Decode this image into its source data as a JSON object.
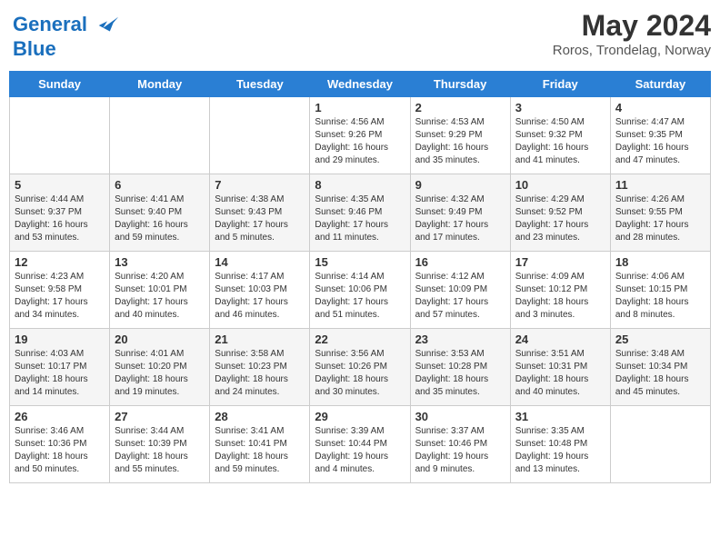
{
  "header": {
    "logo_line1": "General",
    "logo_line2": "Blue",
    "month_year": "May 2024",
    "location": "Roros, Trondelag, Norway"
  },
  "days_of_week": [
    "Sunday",
    "Monday",
    "Tuesday",
    "Wednesday",
    "Thursday",
    "Friday",
    "Saturday"
  ],
  "weeks": [
    [
      {
        "day": "",
        "info": ""
      },
      {
        "day": "",
        "info": ""
      },
      {
        "day": "",
        "info": ""
      },
      {
        "day": "1",
        "info": "Sunrise: 4:56 AM\nSunset: 9:26 PM\nDaylight: 16 hours\nand 29 minutes."
      },
      {
        "day": "2",
        "info": "Sunrise: 4:53 AM\nSunset: 9:29 PM\nDaylight: 16 hours\nand 35 minutes."
      },
      {
        "day": "3",
        "info": "Sunrise: 4:50 AM\nSunset: 9:32 PM\nDaylight: 16 hours\nand 41 minutes."
      },
      {
        "day": "4",
        "info": "Sunrise: 4:47 AM\nSunset: 9:35 PM\nDaylight: 16 hours\nand 47 minutes."
      }
    ],
    [
      {
        "day": "5",
        "info": "Sunrise: 4:44 AM\nSunset: 9:37 PM\nDaylight: 16 hours\nand 53 minutes."
      },
      {
        "day": "6",
        "info": "Sunrise: 4:41 AM\nSunset: 9:40 PM\nDaylight: 16 hours\nand 59 minutes."
      },
      {
        "day": "7",
        "info": "Sunrise: 4:38 AM\nSunset: 9:43 PM\nDaylight: 17 hours\nand 5 minutes."
      },
      {
        "day": "8",
        "info": "Sunrise: 4:35 AM\nSunset: 9:46 PM\nDaylight: 17 hours\nand 11 minutes."
      },
      {
        "day": "9",
        "info": "Sunrise: 4:32 AM\nSunset: 9:49 PM\nDaylight: 17 hours\nand 17 minutes."
      },
      {
        "day": "10",
        "info": "Sunrise: 4:29 AM\nSunset: 9:52 PM\nDaylight: 17 hours\nand 23 minutes."
      },
      {
        "day": "11",
        "info": "Sunrise: 4:26 AM\nSunset: 9:55 PM\nDaylight: 17 hours\nand 28 minutes."
      }
    ],
    [
      {
        "day": "12",
        "info": "Sunrise: 4:23 AM\nSunset: 9:58 PM\nDaylight: 17 hours\nand 34 minutes."
      },
      {
        "day": "13",
        "info": "Sunrise: 4:20 AM\nSunset: 10:01 PM\nDaylight: 17 hours\nand 40 minutes."
      },
      {
        "day": "14",
        "info": "Sunrise: 4:17 AM\nSunset: 10:03 PM\nDaylight: 17 hours\nand 46 minutes."
      },
      {
        "day": "15",
        "info": "Sunrise: 4:14 AM\nSunset: 10:06 PM\nDaylight: 17 hours\nand 51 minutes."
      },
      {
        "day": "16",
        "info": "Sunrise: 4:12 AM\nSunset: 10:09 PM\nDaylight: 17 hours\nand 57 minutes."
      },
      {
        "day": "17",
        "info": "Sunrise: 4:09 AM\nSunset: 10:12 PM\nDaylight: 18 hours\nand 3 minutes."
      },
      {
        "day": "18",
        "info": "Sunrise: 4:06 AM\nSunset: 10:15 PM\nDaylight: 18 hours\nand 8 minutes."
      }
    ],
    [
      {
        "day": "19",
        "info": "Sunrise: 4:03 AM\nSunset: 10:17 PM\nDaylight: 18 hours\nand 14 minutes."
      },
      {
        "day": "20",
        "info": "Sunrise: 4:01 AM\nSunset: 10:20 PM\nDaylight: 18 hours\nand 19 minutes."
      },
      {
        "day": "21",
        "info": "Sunrise: 3:58 AM\nSunset: 10:23 PM\nDaylight: 18 hours\nand 24 minutes."
      },
      {
        "day": "22",
        "info": "Sunrise: 3:56 AM\nSunset: 10:26 PM\nDaylight: 18 hours\nand 30 minutes."
      },
      {
        "day": "23",
        "info": "Sunrise: 3:53 AM\nSunset: 10:28 PM\nDaylight: 18 hours\nand 35 minutes."
      },
      {
        "day": "24",
        "info": "Sunrise: 3:51 AM\nSunset: 10:31 PM\nDaylight: 18 hours\nand 40 minutes."
      },
      {
        "day": "25",
        "info": "Sunrise: 3:48 AM\nSunset: 10:34 PM\nDaylight: 18 hours\nand 45 minutes."
      }
    ],
    [
      {
        "day": "26",
        "info": "Sunrise: 3:46 AM\nSunset: 10:36 PM\nDaylight: 18 hours\nand 50 minutes."
      },
      {
        "day": "27",
        "info": "Sunrise: 3:44 AM\nSunset: 10:39 PM\nDaylight: 18 hours\nand 55 minutes."
      },
      {
        "day": "28",
        "info": "Sunrise: 3:41 AM\nSunset: 10:41 PM\nDaylight: 18 hours\nand 59 minutes."
      },
      {
        "day": "29",
        "info": "Sunrise: 3:39 AM\nSunset: 10:44 PM\nDaylight: 19 hours\nand 4 minutes."
      },
      {
        "day": "30",
        "info": "Sunrise: 3:37 AM\nSunset: 10:46 PM\nDaylight: 19 hours\nand 9 minutes."
      },
      {
        "day": "31",
        "info": "Sunrise: 3:35 AM\nSunset: 10:48 PM\nDaylight: 19 hours\nand 13 minutes."
      },
      {
        "day": "",
        "info": ""
      }
    ]
  ]
}
